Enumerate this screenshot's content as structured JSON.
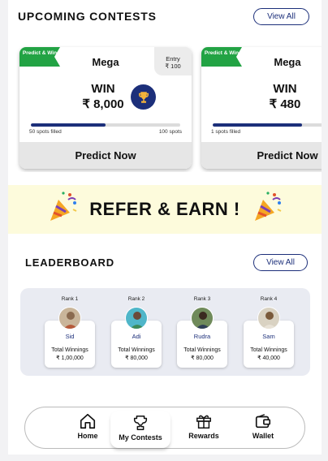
{
  "upcoming": {
    "title": "UPCOMING CONTESTS",
    "view_all": "View All",
    "contests": [
      {
        "badge": "Predict & Win",
        "name": "Mega",
        "entry_label": "Entry",
        "entry_fee": "₹ 100",
        "win_label": "WIN",
        "prize": "₹ 8,000",
        "filled_fraction": 0.5,
        "spots_filled": "50 spots filled",
        "total_spots": "100 spots",
        "cta": "Predict Now"
      },
      {
        "badge": "Predict & Win",
        "name": "Mega",
        "entry_label": "",
        "entry_fee": "",
        "win_label": "WIN",
        "prize": "₹ 480",
        "filled_fraction": 0.6,
        "spots_filled": "1 spots filled",
        "total_spots": "",
        "cta": "Predict Now"
      }
    ]
  },
  "refer": {
    "text": "REFER & EARN !"
  },
  "leaderboard": {
    "title": "LEADERBOARD",
    "view_all": "View All",
    "entries": [
      {
        "rank": "Rank 1",
        "name": "Sid",
        "winnings_label": "Total Winnings",
        "amount": "₹ 1,00,000"
      },
      {
        "rank": "Rank 2",
        "name": "Adi",
        "winnings_label": "Total Winnings",
        "amount": "₹ 80,000"
      },
      {
        "rank": "Rank 3",
        "name": "Rudra",
        "winnings_label": "Total Winnings",
        "amount": "₹ 80,000"
      },
      {
        "rank": "Rank 4",
        "name": "Sam",
        "winnings_label": "Total Winnings",
        "amount": "₹ 40,000"
      }
    ]
  },
  "nav": {
    "items": [
      {
        "label": "Home",
        "icon": "home-icon"
      },
      {
        "label": "My Contests",
        "icon": "trophy-icon"
      },
      {
        "label": "Rewards",
        "icon": "gift-icon"
      },
      {
        "label": "Wallet",
        "icon": "wallet-icon"
      }
    ],
    "active": "My Contests"
  },
  "colors": {
    "primary": "#1c2f7a",
    "badge_green": "#22a344",
    "banner_bg": "#fdfbdc"
  }
}
